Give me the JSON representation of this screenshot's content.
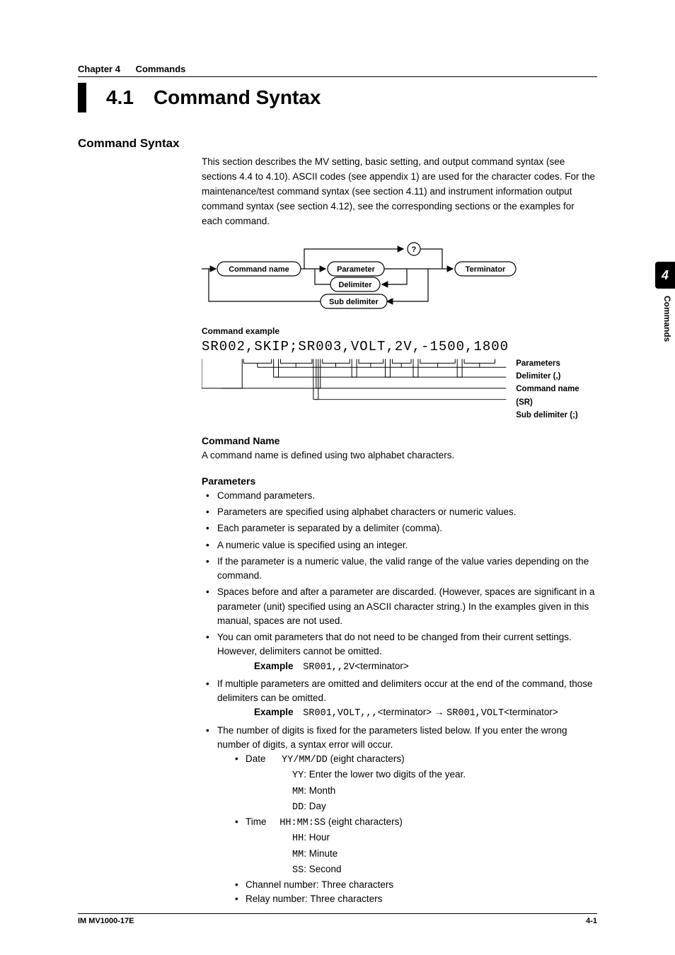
{
  "chapter": {
    "label": "Chapter 4",
    "title": "Commands"
  },
  "section": {
    "number": "4.1",
    "title": "Command Syntax"
  },
  "subsection_title": "Command Syntax",
  "intro": "This section describes the MV setting, basic setting, and output command syntax (see sections 4.4 to 4.10). ASCII codes (see appendix 1) are used for the character codes. For the maintenance/test command syntax (see section 4.11) and instrument information output command syntax (see section 4.12), see the corresponding sections or the examples for each command.",
  "diagram1": {
    "command_name": "Command name",
    "parameter": "Parameter",
    "delimiter": "Delimiter",
    "sub_delimiter": "Sub delimiter",
    "terminator": "Terminator",
    "question": "?"
  },
  "example_heading": "Command example",
  "example_code": "SR002,SKIP;SR003,VOLT,2V,-1500,1800",
  "example_labels": {
    "parameters": "Parameters",
    "delimiter": "Delimiter (,)",
    "command_name": "Command name (SR)",
    "sub_delimiter": "Sub delimiter (;)"
  },
  "command_name_heading": "Command Name",
  "command_name_text": "A command name is defined using two alphabet characters.",
  "parameters_heading": "Parameters",
  "bullets": {
    "b1": "Command parameters.",
    "b2": "Parameters are specified using alphabet characters or numeric values.",
    "b3": "Each parameter is separated by a delimiter (comma).",
    "b4": "A numeric value is specified using an integer.",
    "b5": "If the parameter is a numeric value, the valid range of the value varies depending on the command.",
    "b6": "Spaces before and after a parameter are discarded. (However, spaces are significant in a parameter (unit) specified using an ASCII character string.) In the examples given in this manual, spaces are not used.",
    "b7": "You can omit parameters that do not need to be changed from their current settings. However, delimiters cannot be omitted.",
    "b8": "If multiple parameters are omitted and delimiters occur at the end of the command, those delimiters can be omitted.",
    "b9": "The number of digits is fixed for the parameters listed below. If you enter the wrong number of digits, a syntax error will occur."
  },
  "examples": {
    "label": "Example",
    "e1_code": "SR001,,2V",
    "e1_tail": "<terminator>",
    "e2_code_a": "SR001,VOLT,,,",
    "e2_mid": "<terminator> → ",
    "e2_code_b": "SR001,VOLT",
    "e2_tail": "<terminator>"
  },
  "fixed_digits": {
    "date_label": "Date",
    "date_format": "YY/MM/DD",
    "date_desc": " (eight characters)",
    "yy": "YY",
    "yy_desc": ": Enter the lower two digits of the year.",
    "mm": "MM",
    "mm_desc": ": Month",
    "dd": "DD",
    "dd_desc": ": Day",
    "time_label": "Time",
    "time_format": "HH:MM:SS",
    "time_desc": " (eight characters)",
    "hh": "HH",
    "hh_desc": ": Hour",
    "mm2": "MM",
    "mm2_desc": ": Minute",
    "ss": "SS",
    "ss_desc": ": Second",
    "chan": "Channel number: Three characters",
    "relay": "Relay number: Three characters"
  },
  "side": {
    "tab": "4",
    "label": "Commands"
  },
  "footer": {
    "left": "IM MV1000-17E",
    "right": "4-1"
  }
}
